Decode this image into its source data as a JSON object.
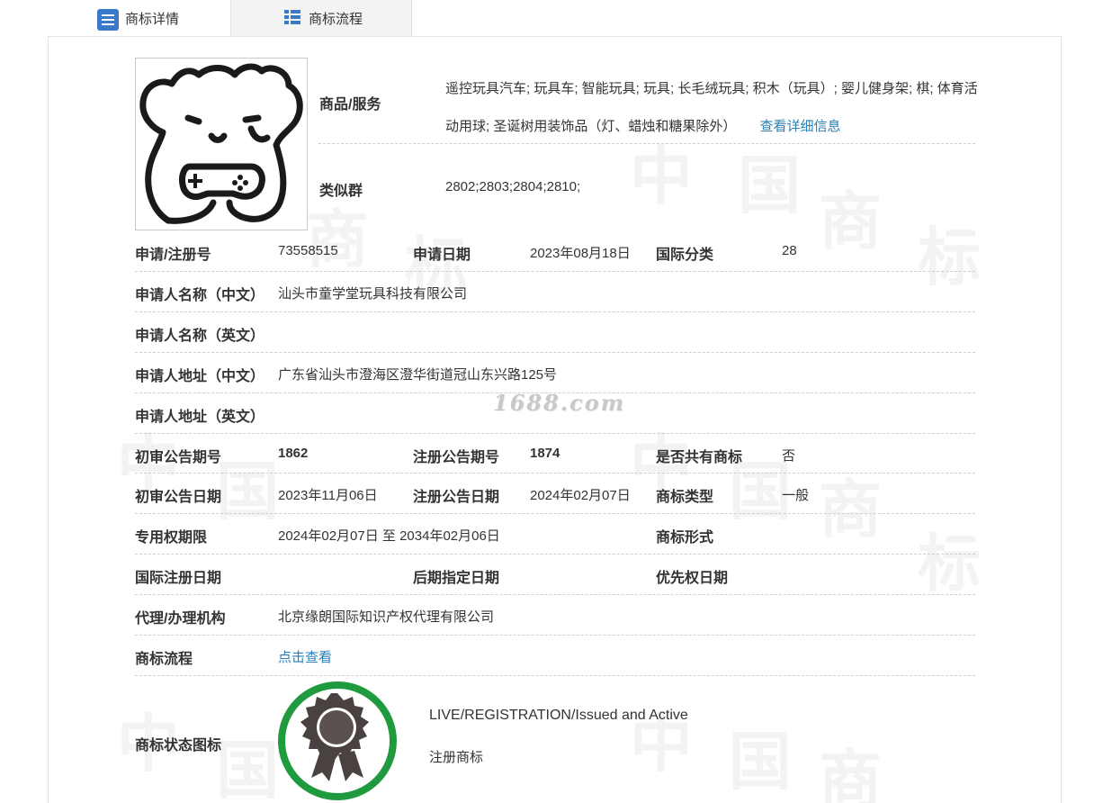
{
  "tabs": [
    {
      "label": "商标详情",
      "active": true
    },
    {
      "label": "商标流程",
      "active": false
    }
  ],
  "watermark": {
    "site": "1688.com"
  },
  "goods": {
    "label": "商品/服务",
    "text": "遥控玩具汽车; 玩具车; 智能玩具; 玩具; 长毛绒玩具; 积木（玩具）; 婴儿健身架; 棋; 体育活动用球; 圣诞树用装饰品（灯、蜡烛和糖果除外）",
    "detail_link": "查看详细信息"
  },
  "similar_group": {
    "label": "类似群",
    "value": "2802;2803;2804;2810;"
  },
  "fields": {
    "reg_no_label": "申请/注册号",
    "reg_no": "73558515",
    "apply_date_label": "申请日期",
    "apply_date": "2023年08月18日",
    "intl_class_label": "国际分类",
    "intl_class": "28",
    "applicant_cn_label": "申请人名称（中文）",
    "applicant_cn": "汕头市童学堂玩具科技有限公司",
    "applicant_en_label": "申请人名称（英文）",
    "applicant_en": "",
    "address_cn_label": "申请人地址（中文）",
    "address_cn": "广东省汕头市澄海区澄华街道冠山东兴路125号",
    "address_en_label": "申请人地址（英文）",
    "address_en": "",
    "prelim_no_label": "初审公告期号",
    "prelim_no": "1862",
    "reg_pub_no_label": "注册公告期号",
    "reg_pub_no": "1874",
    "shared_label": "是否共有商标",
    "shared": "否",
    "prelim_date_label": "初审公告日期",
    "prelim_date": "2023年11月06日",
    "reg_pub_date_label": "注册公告日期",
    "reg_pub_date": "2024年02月07日",
    "tm_type_label": "商标类型",
    "tm_type": "一般",
    "exclusive_label": "专用权期限",
    "exclusive": "2024年02月07日 至 2034年02月06日",
    "tm_form_label": "商标形式",
    "tm_form": "",
    "intl_reg_date_label": "国际注册日期",
    "intl_reg_date": "",
    "later_date_label": "后期指定日期",
    "later_date": "",
    "priority_date_label": "优先权日期",
    "priority_date": "",
    "agent_label": "代理/办理机构",
    "agent": "北京缘朗国际知识产权代理有限公司",
    "flow_label": "商标流程",
    "flow_link": "点击查看",
    "status_icon_label": "商标状态图标",
    "status_en": "LIVE/REGISTRATION/Issued and Active",
    "status_cn": "注册商标"
  },
  "colors": {
    "link": "#2a7fb8",
    "badge_ring": "#1f9a3f",
    "tab_icon": "#3a78c8"
  }
}
